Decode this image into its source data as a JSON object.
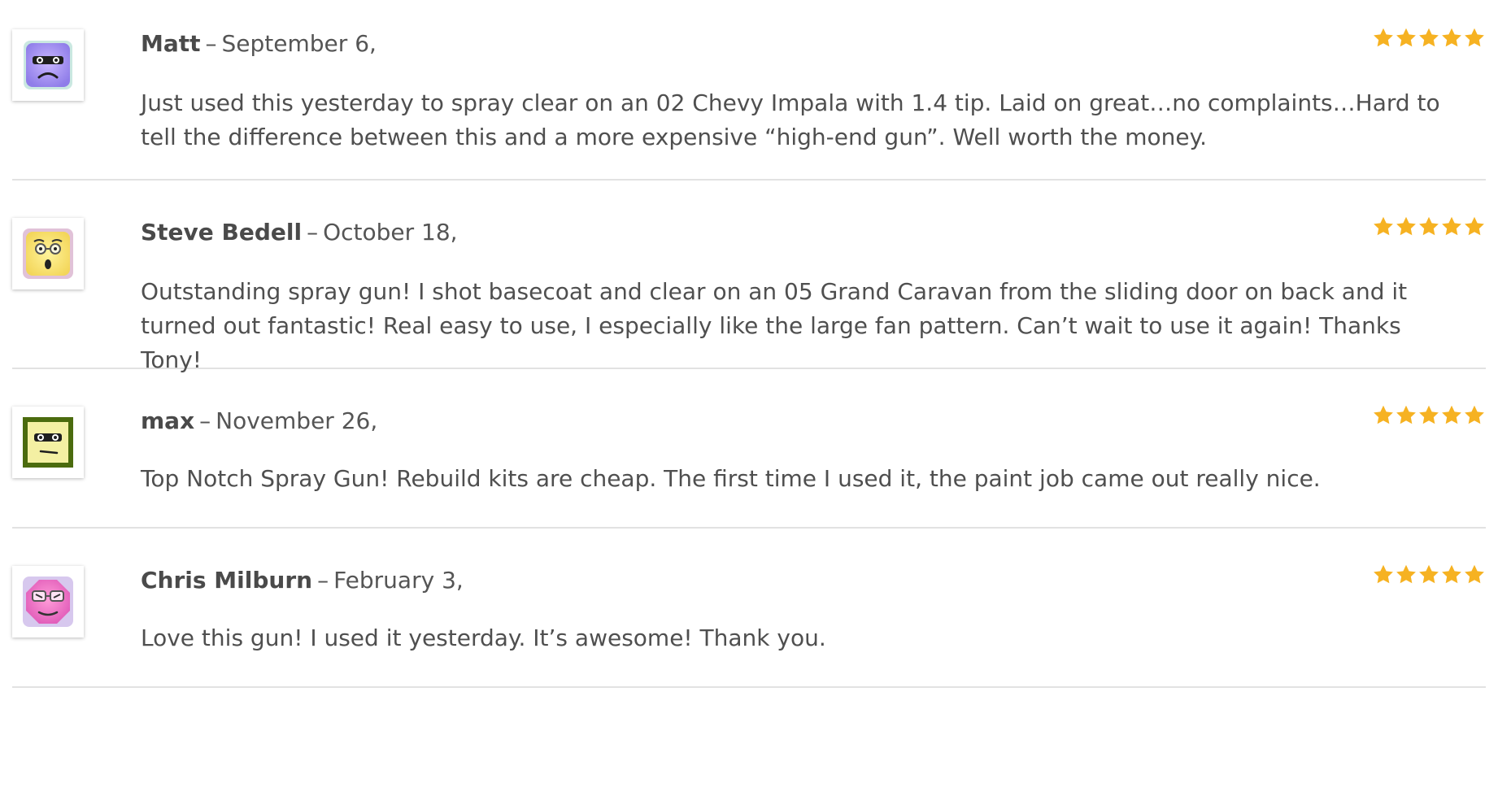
{
  "reviews": [
    {
      "author": "Matt",
      "separator": "–",
      "date": "September 6,",
      "rating": 5,
      "text": "Just used this yesterday to spray clear on an 02 Chevy Impala with 1.4 tip. Laid on great…no complaints…Hard to tell the difference between this and a more expensive “high-end gun”. Well worth the money.",
      "avatar_icon": "sad-purple-face-icon"
    },
    {
      "author": "Steve Bedell",
      "separator": "–",
      "date": "October 18,",
      "rating": 5,
      "text": "Outstanding spray gun! I shot basecoat and clear on an 05 Grand Caravan from the sliding door on back and it turned out fantastic! Real easy to use, I especially like the large fan pattern. Can’t wait to use it again! Thanks Tony!",
      "avatar_icon": "surprised-yellow-face-glasses-icon"
    },
    {
      "author": "max",
      "separator": "–",
      "date": "November 26,",
      "rating": 5,
      "text": "Top Notch Spray Gun! Rebuild kits are cheap. The first time I used it, the paint job came out really nice.",
      "avatar_icon": "neutral-yellow-face-green-frame-icon"
    },
    {
      "author": "Chris Milburn",
      "separator": "–",
      "date": "February 3,",
      "rating": 5,
      "text": "Love this gun! I used it yesterday. It’s awesome! Thank you.",
      "avatar_icon": "pink-octagon-face-glasses-icon"
    }
  ],
  "colors": {
    "star": "#f6b222",
    "divider": "#e2e2e2",
    "text": "#4f4f4f"
  }
}
